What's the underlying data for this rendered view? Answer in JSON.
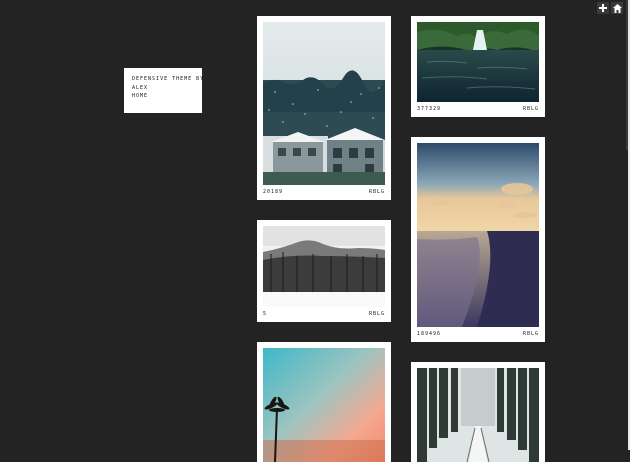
{
  "blog": {
    "title_line": "DEFENSIVE THEME BY",
    "author": "ALEX",
    "home": "HOME"
  },
  "controls": {
    "follow_icon": "plus-icon",
    "dashboard_icon": "home-icon"
  },
  "posts": [
    {
      "id_label": "20189",
      "reblog": "RBLG",
      "subject": "snowy houses"
    },
    {
      "id_label": "377329",
      "reblog": "RBLG",
      "subject": "waterfall lake"
    },
    {
      "id_label": "5",
      "reblog": "RBLG",
      "subject": "winter hills"
    },
    {
      "id_label": "189496",
      "reblog": "RBLG",
      "subject": "beach sunset"
    },
    {
      "id_label": "",
      "reblog": "",
      "subject": "palm sunset"
    },
    {
      "id_label": "",
      "reblog": "",
      "subject": "snowy forest road"
    }
  ],
  "colors": {
    "background": "#232323",
    "card": "#ffffff",
    "text": "#1a1a1a"
  }
}
